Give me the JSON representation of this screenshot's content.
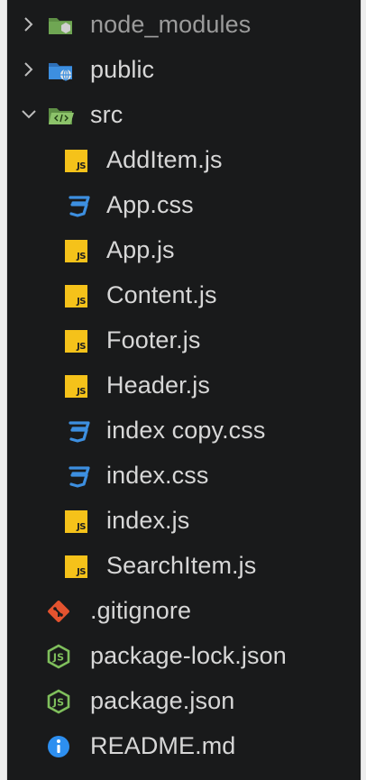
{
  "colors": {
    "background": "#191a1b",
    "text": "#d7d7d7",
    "dim_text": "#9b9b9b",
    "folder_green": "#7fbf5c",
    "folder_blue": "#3d8fe0",
    "js_yellow": "#f5c21a",
    "css_blue": "#3d8fe0",
    "git_red": "#e4532f",
    "node_green": "#7fbf5c",
    "info_blue": "#2d8ff0"
  },
  "tree": {
    "items": [
      {
        "label": "node_modules",
        "kind": "folder",
        "icon": "node-folder-icon",
        "expanded": false
      },
      {
        "label": "public",
        "kind": "folder",
        "icon": "public-folder-icon",
        "expanded": false
      },
      {
        "label": "src",
        "kind": "folder",
        "icon": "src-folder-icon",
        "expanded": true
      },
      {
        "label": "AddItem.js",
        "kind": "file",
        "icon": "javascript-icon"
      },
      {
        "label": "App.css",
        "kind": "file",
        "icon": "css-icon"
      },
      {
        "label": "App.js",
        "kind": "file",
        "icon": "javascript-icon"
      },
      {
        "label": "Content.js",
        "kind": "file",
        "icon": "javascript-icon"
      },
      {
        "label": "Footer.js",
        "kind": "file",
        "icon": "javascript-icon"
      },
      {
        "label": "Header.js",
        "kind": "file",
        "icon": "javascript-icon"
      },
      {
        "label": "index copy.css",
        "kind": "file",
        "icon": "css-icon"
      },
      {
        "label": "index.css",
        "kind": "file",
        "icon": "css-icon"
      },
      {
        "label": "index.js",
        "kind": "file",
        "icon": "javascript-icon"
      },
      {
        "label": "SearchItem.js",
        "kind": "file",
        "icon": "javascript-icon"
      },
      {
        "label": ".gitignore",
        "kind": "file",
        "icon": "git-icon"
      },
      {
        "label": "package-lock.json",
        "kind": "file",
        "icon": "nodejs-icon"
      },
      {
        "label": "package.json",
        "kind": "file",
        "icon": "nodejs-icon"
      },
      {
        "label": "README.md",
        "kind": "file",
        "icon": "info-icon"
      }
    ],
    "js_badge": "JS"
  }
}
